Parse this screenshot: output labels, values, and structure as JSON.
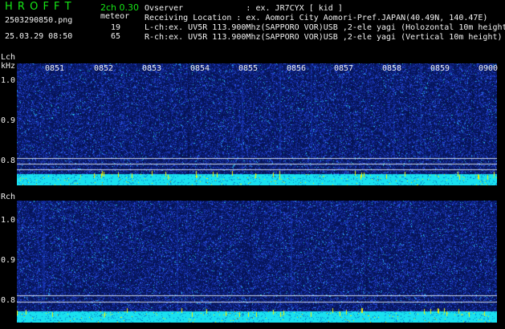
{
  "header": {
    "brand": "H R O F F T",
    "mode": "2ch 0.30",
    "filename": "2503290850.png",
    "meteor_label": "meteor",
    "datetime": "25.03.29 08:50",
    "lch_count": "19",
    "rch_count": "65",
    "observer_line": "Ovserver             : ex. JR7CYX [ kid ]",
    "location_line": "Receiving Location : ex. Aomori City Aomori-Pref.JAPAN(40.49N, 140.47E)",
    "lch_line": "L-ch:ex. UV5R 113.900Mhz(SAPPORO VOR)USB ,2-ele yagi (Holozontal 10m height)",
    "rch_line": "R-ch:ex. UV5R 113.900Mhz(SAPPORO VOR)USB ,2-ele yagi (Vertical 10m height)"
  },
  "lch": {
    "label": "Lch",
    "unit": "kHz",
    "y_labels": [
      "1.0",
      "0.9",
      "0.8"
    ],
    "time_labels": [
      "0851",
      "0852",
      "0853",
      "0854",
      "0855",
      "0856",
      "0857",
      "0858",
      "0859",
      "0900"
    ]
  },
  "rch": {
    "label": "Rch",
    "y_labels": [
      "1.0",
      "0.9",
      "0.8"
    ]
  },
  "colors": {
    "background": "#000000",
    "panel": "#061457",
    "noise_blue": "#2a4cf0",
    "noise_cyan": "#20d0e8",
    "strip_cyan": "#19e0f0",
    "strip_yellow": "#f0f000",
    "text_green": "#16e616"
  }
}
